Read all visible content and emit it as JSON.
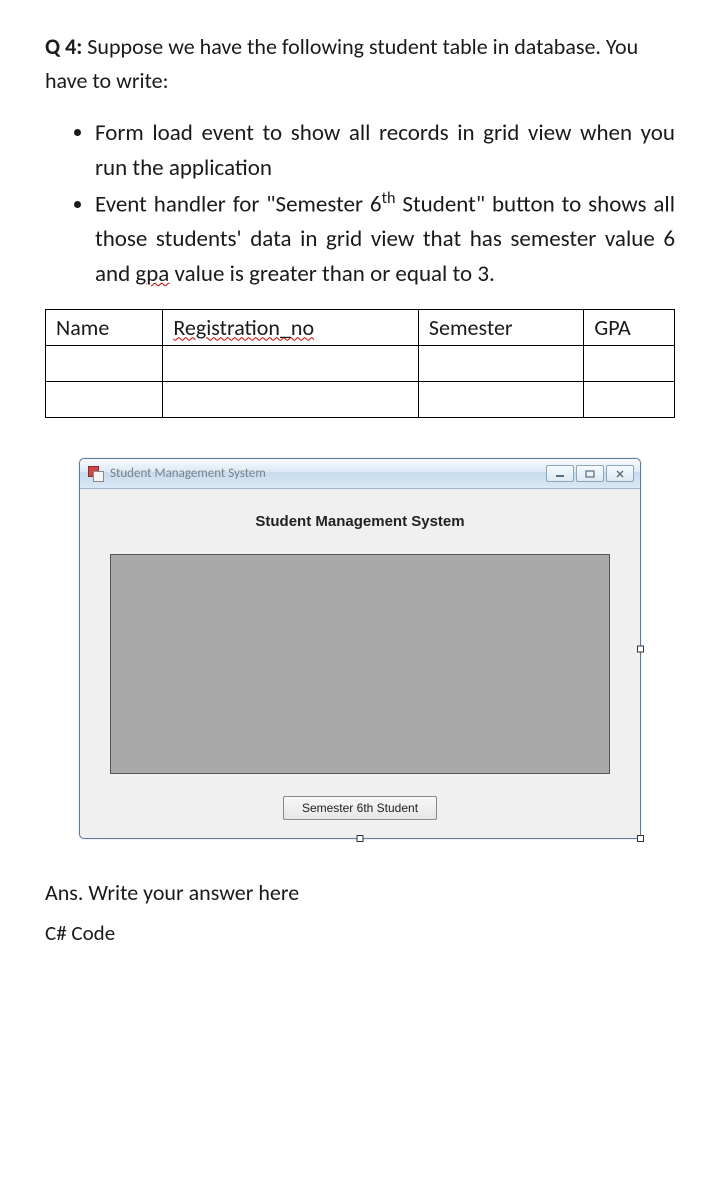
{
  "question": {
    "label": "Q 4:",
    "intro": "Suppose we have the following student table in database. You have to write:",
    "bullets": [
      {
        "pre": "Form load event to show all records in grid view when you run the application",
        "parts": [
          "Form load event to show all records in grid view when you run the application"
        ]
      },
      {
        "parts": [
          "Event handler for \"Semester 6",
          "th",
          "Student\" button to shows all those students' data in grid view that has semester value 6 and ",
          "gpa",
          " value is greater than or equal to 3."
        ]
      }
    ]
  },
  "table": {
    "headers": [
      "Name",
      "Registration_no",
      "Semester",
      "GPA"
    ]
  },
  "winform": {
    "title": "Student Management System",
    "heading": "Student Management System",
    "button_label": "Semester 6th Student",
    "controls": {
      "min": "▭",
      "max": "▣",
      "close": "✕"
    }
  },
  "answer": {
    "line": "Ans. Write your answer here",
    "code_heading": "C# Code"
  }
}
